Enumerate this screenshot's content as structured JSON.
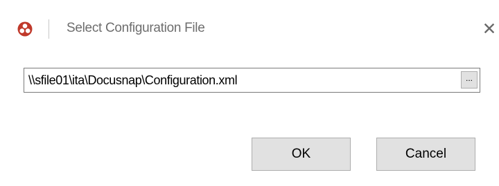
{
  "window": {
    "title": "Select Configuration File",
    "app_icon": "docusnap-logo-icon",
    "close_icon": "close-icon",
    "accent_color": "#c0392b"
  },
  "form": {
    "path_value": "\\\\sfile01\\ita\\Docusnap\\Configuration.xml",
    "browse_label": "..."
  },
  "buttons": {
    "ok_label": "OK",
    "cancel_label": "Cancel"
  }
}
